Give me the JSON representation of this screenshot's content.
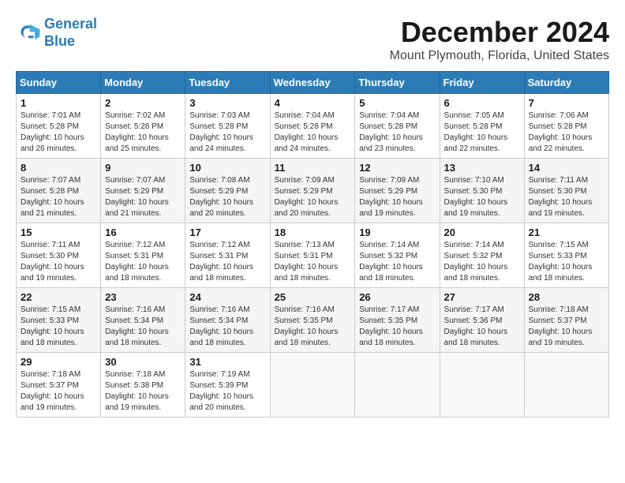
{
  "logo": {
    "line1": "General",
    "line2": "Blue"
  },
  "title": "December 2024",
  "subtitle": "Mount Plymouth, Florida, United States",
  "weekdays": [
    "Sunday",
    "Monday",
    "Tuesday",
    "Wednesday",
    "Thursday",
    "Friday",
    "Saturday"
  ],
  "weeks": [
    [
      {
        "day": "1",
        "sunrise": "7:01 AM",
        "sunset": "5:28 PM",
        "daylight": "10 hours and 26 minutes."
      },
      {
        "day": "2",
        "sunrise": "7:02 AM",
        "sunset": "5:28 PM",
        "daylight": "10 hours and 25 minutes."
      },
      {
        "day": "3",
        "sunrise": "7:03 AM",
        "sunset": "5:28 PM",
        "daylight": "10 hours and 24 minutes."
      },
      {
        "day": "4",
        "sunrise": "7:04 AM",
        "sunset": "5:28 PM",
        "daylight": "10 hours and 24 minutes."
      },
      {
        "day": "5",
        "sunrise": "7:04 AM",
        "sunset": "5:28 PM",
        "daylight": "10 hours and 23 minutes."
      },
      {
        "day": "6",
        "sunrise": "7:05 AM",
        "sunset": "5:28 PM",
        "daylight": "10 hours and 22 minutes."
      },
      {
        "day": "7",
        "sunrise": "7:06 AM",
        "sunset": "5:28 PM",
        "daylight": "10 hours and 22 minutes."
      }
    ],
    [
      {
        "day": "8",
        "sunrise": "7:07 AM",
        "sunset": "5:28 PM",
        "daylight": "10 hours and 21 minutes."
      },
      {
        "day": "9",
        "sunrise": "7:07 AM",
        "sunset": "5:29 PM",
        "daylight": "10 hours and 21 minutes."
      },
      {
        "day": "10",
        "sunrise": "7:08 AM",
        "sunset": "5:29 PM",
        "daylight": "10 hours and 20 minutes."
      },
      {
        "day": "11",
        "sunrise": "7:09 AM",
        "sunset": "5:29 PM",
        "daylight": "10 hours and 20 minutes."
      },
      {
        "day": "12",
        "sunrise": "7:09 AM",
        "sunset": "5:29 PM",
        "daylight": "10 hours and 19 minutes."
      },
      {
        "day": "13",
        "sunrise": "7:10 AM",
        "sunset": "5:30 PM",
        "daylight": "10 hours and 19 minutes."
      },
      {
        "day": "14",
        "sunrise": "7:11 AM",
        "sunset": "5:30 PM",
        "daylight": "10 hours and 19 minutes."
      }
    ],
    [
      {
        "day": "15",
        "sunrise": "7:11 AM",
        "sunset": "5:30 PM",
        "daylight": "10 hours and 19 minutes."
      },
      {
        "day": "16",
        "sunrise": "7:12 AM",
        "sunset": "5:31 PM",
        "daylight": "10 hours and 18 minutes."
      },
      {
        "day": "17",
        "sunrise": "7:12 AM",
        "sunset": "5:31 PM",
        "daylight": "10 hours and 18 minutes."
      },
      {
        "day": "18",
        "sunrise": "7:13 AM",
        "sunset": "5:31 PM",
        "daylight": "10 hours and 18 minutes."
      },
      {
        "day": "19",
        "sunrise": "7:14 AM",
        "sunset": "5:32 PM",
        "daylight": "10 hours and 18 minutes."
      },
      {
        "day": "20",
        "sunrise": "7:14 AM",
        "sunset": "5:32 PM",
        "daylight": "10 hours and 18 minutes."
      },
      {
        "day": "21",
        "sunrise": "7:15 AM",
        "sunset": "5:33 PM",
        "daylight": "10 hours and 18 minutes."
      }
    ],
    [
      {
        "day": "22",
        "sunrise": "7:15 AM",
        "sunset": "5:33 PM",
        "daylight": "10 hours and 18 minutes."
      },
      {
        "day": "23",
        "sunrise": "7:16 AM",
        "sunset": "5:34 PM",
        "daylight": "10 hours and 18 minutes."
      },
      {
        "day": "24",
        "sunrise": "7:16 AM",
        "sunset": "5:34 PM",
        "daylight": "10 hours and 18 minutes."
      },
      {
        "day": "25",
        "sunrise": "7:16 AM",
        "sunset": "5:35 PM",
        "daylight": "10 hours and 18 minutes."
      },
      {
        "day": "26",
        "sunrise": "7:17 AM",
        "sunset": "5:35 PM",
        "daylight": "10 hours and 18 minutes."
      },
      {
        "day": "27",
        "sunrise": "7:17 AM",
        "sunset": "5:36 PM",
        "daylight": "10 hours and 18 minutes."
      },
      {
        "day": "28",
        "sunrise": "7:18 AM",
        "sunset": "5:37 PM",
        "daylight": "10 hours and 19 minutes."
      }
    ],
    [
      {
        "day": "29",
        "sunrise": "7:18 AM",
        "sunset": "5:37 PM",
        "daylight": "10 hours and 19 minutes."
      },
      {
        "day": "30",
        "sunrise": "7:18 AM",
        "sunset": "5:38 PM",
        "daylight": "10 hours and 19 minutes."
      },
      {
        "day": "31",
        "sunrise": "7:19 AM",
        "sunset": "5:39 PM",
        "daylight": "10 hours and 20 minutes."
      },
      null,
      null,
      null,
      null
    ]
  ]
}
